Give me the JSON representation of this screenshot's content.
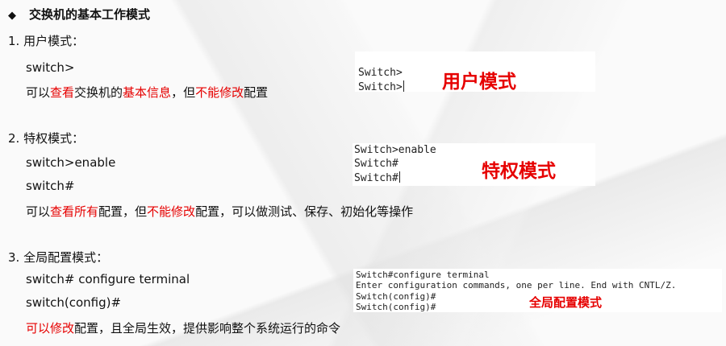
{
  "title": "交换机的基本工作模式",
  "sections": [
    {
      "heading": "1.  用户模式：",
      "cmd1": "switch>",
      "desc": [
        "可以",
        "查看",
        "交换机的",
        "基本信息",
        "，但",
        "不能修改",
        "配置"
      ]
    },
    {
      "heading": "2.  特权模式：",
      "cmd1": "switch>enable",
      "cmd2": "switch#",
      "desc": [
        "可以",
        "查看所有",
        "配置，但",
        "不能修改",
        "配置，可以做测试、保存、初始化等操作"
      ]
    },
    {
      "heading": "3.  全局配置模式：",
      "cmd1": "switch# configure terminal",
      "cmd2": "switch(config)#",
      "desc": [
        "可以修改",
        "配置，且全局生效，提供影响整个系统运行的命令"
      ]
    }
  ],
  "terminals": [
    {
      "lines": [
        "Switch>",
        "Switch>"
      ],
      "caption": "用户模式"
    },
    {
      "lines": [
        "Switch>enable",
        "Switch#",
        "Switch#"
      ],
      "caption": "特权模式"
    },
    {
      "lines": [
        "Switch#configure terminal",
        "Enter configuration commands, one per line.  End with CNTL/Z.",
        "Switch(config)#",
        "Switch(config)#"
      ],
      "caption": "全局配置模式"
    }
  ],
  "colors": {
    "accent": "#e60000",
    "text": "#111111"
  },
  "icons": {
    "bullet": "diamond-icon"
  }
}
